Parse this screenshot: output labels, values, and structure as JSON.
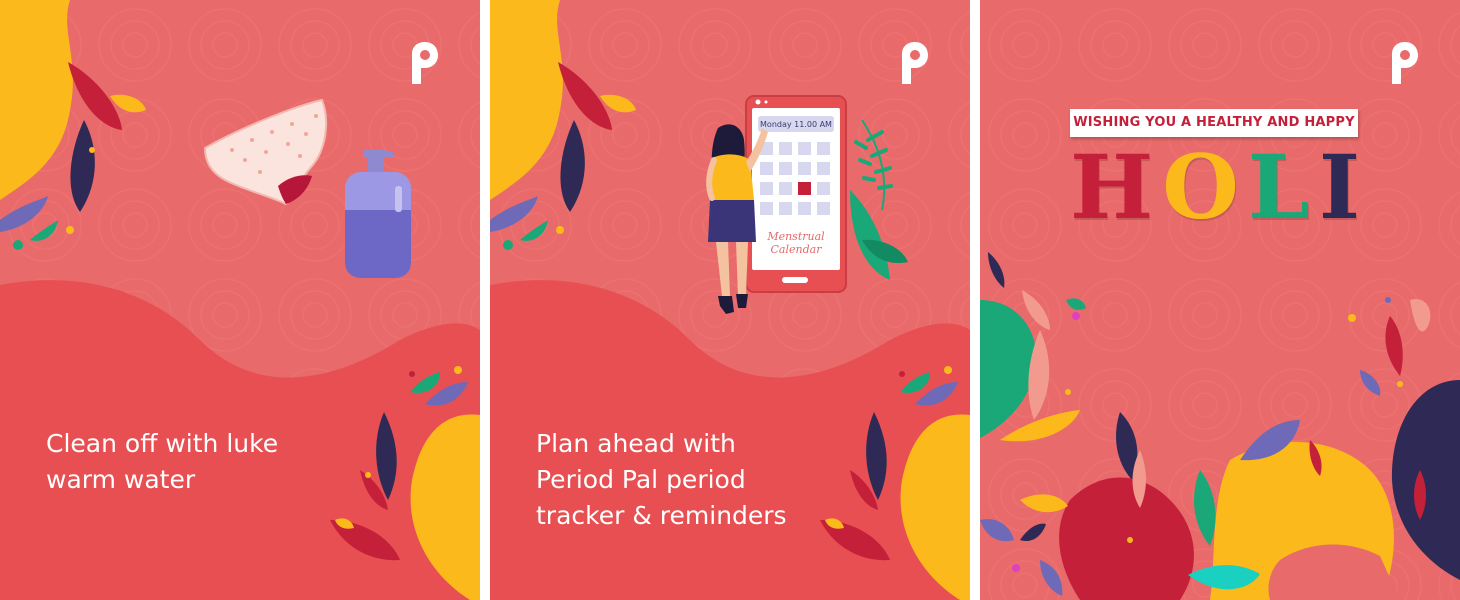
{
  "panels": [
    {
      "caption_lines": [
        "Clean off with luke",
        "warm water"
      ]
    },
    {
      "caption_lines": [
        "Plan ahead with",
        "Period Pal period",
        "tracker & reminders"
      ],
      "calendar": {
        "header": "Monday 11.00 AM",
        "note_lines": [
          "Menstrual",
          "Calendar"
        ]
      }
    },
    {
      "banner": "WISHING YOU A HEALTHY AND HAPPY",
      "headline_letters": [
        "H",
        "O",
        "L",
        "I"
      ]
    }
  ],
  "logo_icon": "period-pal-logo-icon",
  "colors": {
    "background": "#e96a6a",
    "wave": "#e84f52",
    "yellow": "#fbb91c",
    "crimson": "#c4203a",
    "navy": "#2e2a55",
    "green": "#1aa878",
    "purple": "#6e6ab8",
    "white": "#ffffff"
  }
}
